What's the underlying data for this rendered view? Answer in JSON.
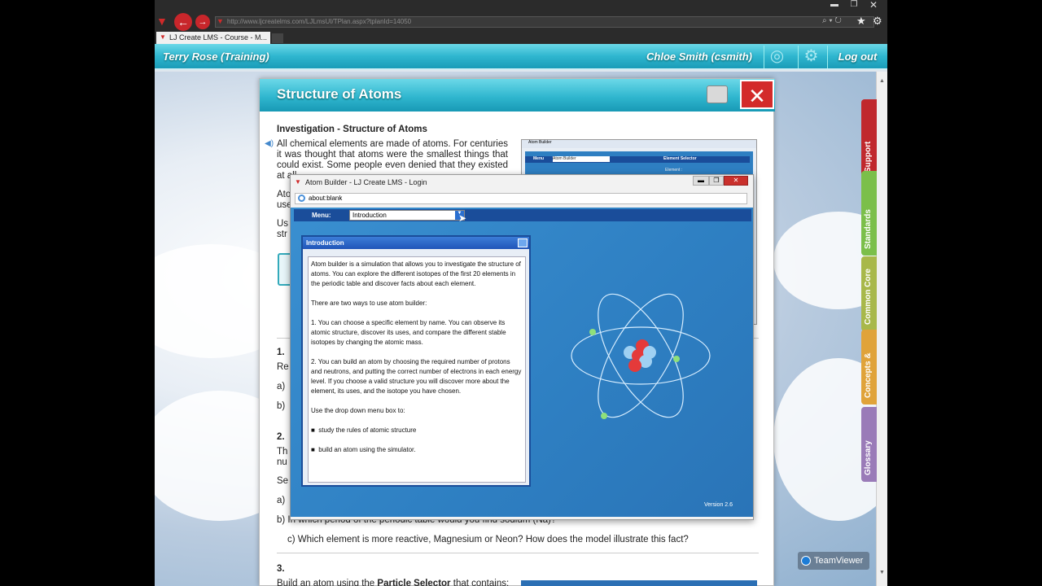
{
  "browser": {
    "url": "http://www.ljcreatelms.com/LJLmsUI/TPlan.aspx?tplanId=14050",
    "tab_title": "LJ Create LMS - Course - M..."
  },
  "lms_header": {
    "left_user": "Terry Rose (Training)",
    "right_user": "Chloe Smith (csmith)",
    "logout": "Log out"
  },
  "panel": {
    "title": "Structure of Atoms",
    "close": "✕",
    "heading": "Investigation - Structure of Atoms",
    "para1": "All chemical elements are made of atoms. For centuries it was thought that atoms were the smallest things that could exist. Some people even denied that they existed at all.",
    "para2_start": "Ato",
    "para2_line2": "use",
    "para3_start": "Us",
    "para3_line2": "str",
    "q1_num": "1.",
    "q1_a": "Re",
    "q1_b": "a)",
    "q1_c": "b)",
    "q2_num": "2.",
    "q2_a": "Th",
    "q2_a2": "nu",
    "q2_b": "Se",
    "q2_c": "a)",
    "q2_d": "b) In which period of the periodic table would you find sodium (Na)?",
    "q2_e": "c) Which element is more reactive, Magnesium or Neon? How does the model illustrate this fact?",
    "q3_num": "3.",
    "q3_a": "Build an atom using the",
    "q3_bold": "Particle Selector",
    "q3_b": "that contains:"
  },
  "side_tabs": [
    {
      "label": "Support",
      "color": "#c0282d"
    },
    {
      "label": "Standards",
      "color": "#7bbf4a"
    },
    {
      "label": "Common Core",
      "color": "#a8b84a"
    },
    {
      "label": "Concepts &",
      "color": "#e0a33a"
    },
    {
      "label": "Glossary",
      "color": "#9a7bb8"
    }
  ],
  "atom_builder": {
    "window_title": "Atom Builder - LJ Create LMS - Login",
    "address": "about:blank",
    "menu_label": "Menu:",
    "menu_value": "Introduction",
    "intro_title": "Introduction",
    "intro_p1": "Atom builder is a simulation that allows you to investigate the structure of atoms. You can explore the different isotopes of the first 20 elements in the periodic table and discover facts about each element.",
    "intro_p2": "There are two ways to use atom builder:",
    "intro_p3": "1. You can choose a specific element by name. You can observe its atomic structure, discover its uses, and compare the different stable isotopes by changing the atomic mass.",
    "intro_p4": "2. You can build an atom by choosing the required number of protons and neutrons, and putting the correct number of electrons in each energy level. If you choose a valid structure you will discover more about the element, its uses, and the isotope you have chosen.",
    "intro_p5": "Use the drop down menu box to:",
    "bullet1": "study the rules of atomic structure",
    "bullet2": "build an atom using the simulator.",
    "version": "Version 2.6"
  },
  "mini_screenshot": {
    "title": "Atom Builder",
    "menu": "Menu",
    "menu_value": "Atom Builder",
    "selector": "Element Selector",
    "element": "Element :"
  },
  "teamviewer": "TeamViewer"
}
